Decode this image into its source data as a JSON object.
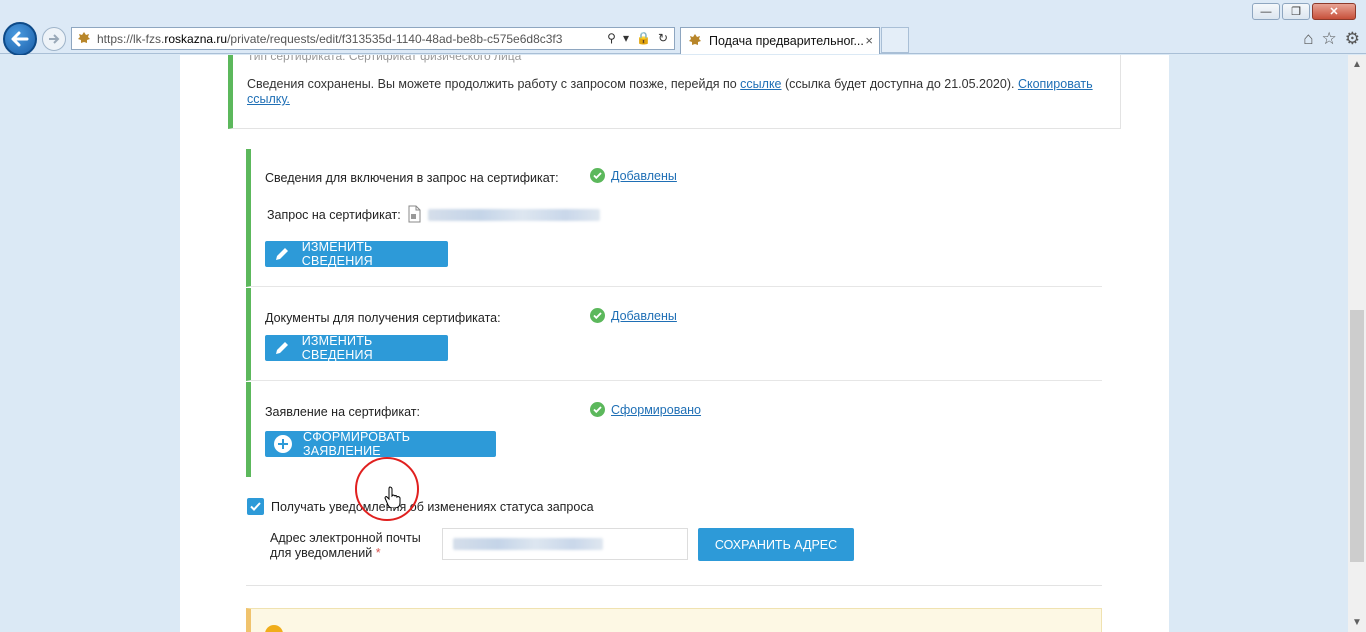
{
  "browser": {
    "url_prefix": "https://lk-fzs.",
    "url_host": "roskazna.ru",
    "url_path": "/private/requests/edit/f313535d-1140-48ad-be8b-c575e6d8c3f3",
    "tab_title": "Подача предварительног...",
    "tab_close": "×",
    "win_min": "—",
    "win_restore": "❐",
    "win_close": "✕"
  },
  "saved_notice": {
    "cut_line": "Тип сертификата:  Сертификат физического лица",
    "text_before": "Сведения сохранены. Вы можете продолжить работу с запросом позже, перейдя по ",
    "link": "ссылке",
    "text_after": " (ссылка будет доступна до 21.05.2020). ",
    "copy_link": "Скопировать ссылку."
  },
  "section_request": {
    "label": "Сведения для включения в запрос на сертификат:",
    "status": "Добавлены",
    "file_label": "Запрос на сертификат:",
    "button": "ИЗМЕНИТЬ СВЕДЕНИЯ"
  },
  "section_docs": {
    "label": "Документы для получения сертификата:",
    "status": "Добавлены",
    "button": "ИЗМЕНИТЬ СВЕДЕНИЯ"
  },
  "section_statement": {
    "label": "Заявление на сертификат:",
    "status": "Сформировано",
    "button": "СФОРМИРОВАТЬ ЗАЯВЛЕНИЕ"
  },
  "notifications": {
    "checkbox_label": "Получать уведомления об изменениях статуса запроса",
    "checked": true,
    "email_label_line1": "Адрес электронной почты",
    "email_label_line2": "для уведомлений",
    "required_mark": "*",
    "save_button": "СОХРАНИТЬ АДРЕС"
  },
  "colors": {
    "accent": "#2d9ad8",
    "success": "#5cb85c",
    "link": "#1f6fb5"
  }
}
